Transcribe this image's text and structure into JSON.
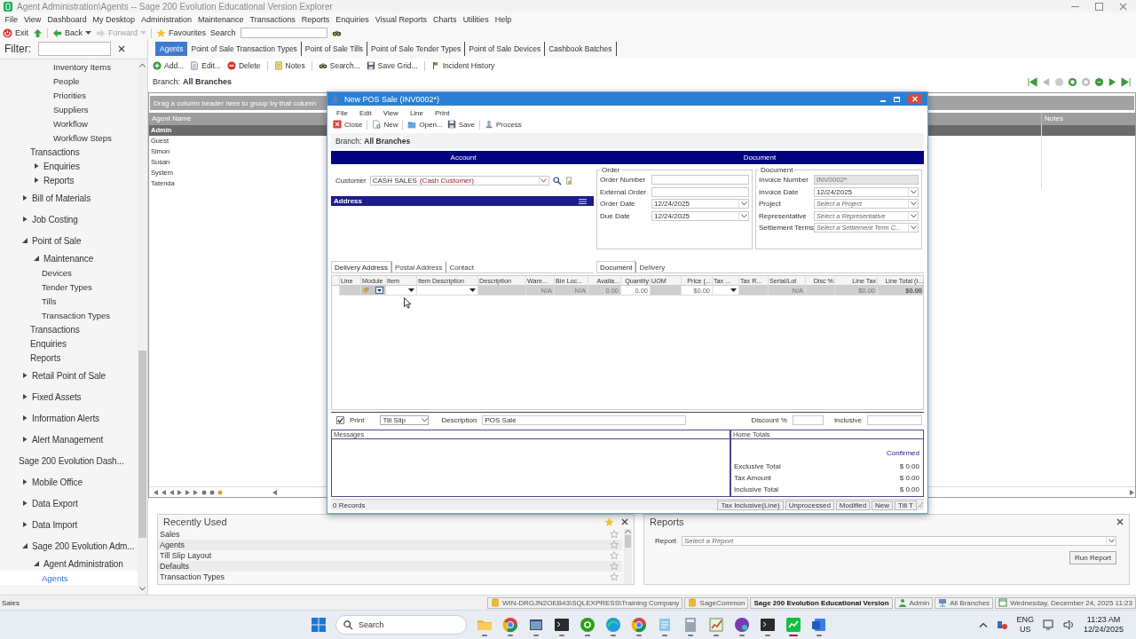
{
  "window": {
    "title": "Agent Administration\\Agents -- Sage 200 Evolution Educational Version Explorer"
  },
  "menu": [
    "File",
    "View",
    "Dashboard",
    "My Desktop",
    "Administration",
    "Maintenance",
    "Transactions",
    "Reports",
    "Enquiries",
    "Visual Reports",
    "Charts",
    "Utilities",
    "Help"
  ],
  "toolbar": [
    {
      "kind": "exit",
      "label": "Exit",
      "disabled": false
    },
    {
      "kind": "up",
      "disabled": false
    },
    {
      "kind": "back",
      "label": "Back",
      "disabled": false
    },
    {
      "kind": "forward",
      "label": "Forward",
      "disabled": true
    },
    {
      "kind": "favourites",
      "label": "Favourites",
      "disabled": false
    }
  ],
  "search": {
    "label": "Search"
  },
  "filter": {
    "label": "Filter:"
  },
  "sidebar": {
    "items": [
      {
        "children": [
          {
            "children": [
              {
                "children": [
                  {
                    "label": "Inventory Items",
                    "selected": false
                  },
                  {
                    "label": "People",
                    "selected": false
                  },
                  {
                    "label": "Priorities",
                    "selected": false
                  },
                  {
                    "label": "Suppliers",
                    "selected": false
                  },
                  {
                    "label": "Workflow",
                    "selected": false
                  },
                  {
                    "label": "Workflow Steps",
                    "selected": false
                  }
                ]
              }
            ]
          },
          {
            "label": "Transactions",
            "selected": false
          },
          {
            "label": "Enquiries",
            "expanded": false,
            "selected": false
          },
          {
            "label": "Reports",
            "expanded": false,
            "selected": false
          }
        ]
      },
      {
        "label": "Bill of Materials",
        "expanded": false,
        "selected": false
      },
      {
        "label": "Job Costing",
        "expanded": false,
        "selected": false
      },
      {
        "label": "Point of Sale",
        "expanded": true,
        "selected": false,
        "children": [
          {
            "label": "Maintenance",
            "expanded": true,
            "selected": false,
            "children": [
              {
                "label": "Devices",
                "selected": false
              },
              {
                "label": "Tender Types",
                "selected": false
              },
              {
                "label": "Tills",
                "selected": false
              },
              {
                "label": "Transaction Types",
                "selected": false
              }
            ]
          },
          {
            "label": "Transactions",
            "selected": false
          },
          {
            "label": "Enquiries",
            "selected": false
          },
          {
            "label": "Reports",
            "selected": false
          }
        ]
      },
      {
        "label": "Retail Point of Sale",
        "expanded": false,
        "selected": false
      },
      {
        "label": "Fixed Assets",
        "expanded": false,
        "selected": false
      },
      {
        "label": "Information Alerts",
        "expanded": false,
        "selected": false
      },
      {
        "label": "Alert Management",
        "expanded": false,
        "selected": false
      },
      {
        "label": "Sage 200 Evolution Dash...",
        "selected": false
      },
      {
        "label": "Mobile Office",
        "expanded": false,
        "selected": false
      },
      {
        "label": "Data Export",
        "expanded": false,
        "selected": false
      },
      {
        "label": "Data Import",
        "expanded": false,
        "selected": false
      },
      {
        "label": "Sage 200 Evolution Adm...",
        "expanded": true,
        "selected": false,
        "children": [
          {
            "label": "Agent Administration",
            "expanded": true,
            "selected": false,
            "children": [
              {
                "label": "Agents",
                "selected": true
              }
            ]
          }
        ]
      }
    ]
  },
  "tabs": [
    {
      "label": "Agents",
      "selected": true
    },
    {
      "label": "Point of Sale Transaction Types",
      "selected": false
    },
    {
      "label": "Point of Sale Tills",
      "selected": false
    },
    {
      "label": "Point of Sale Tender Types",
      "selected": false
    },
    {
      "label": "Point of Sale Devices",
      "selected": false
    },
    {
      "label": "Cashbook Batches",
      "selected": false
    }
  ],
  "actions": [
    {
      "kind": "add",
      "label": "Add..."
    },
    {
      "kind": "edit",
      "label": "Edit..."
    },
    {
      "kind": "delete",
      "label": "Delete"
    },
    {
      "kind": "notes",
      "label": "Notes"
    },
    {
      "kind": "search",
      "label": "Search..."
    },
    {
      "kind": "save",
      "label": "Save Grid..."
    },
    {
      "kind": "incident",
      "label": "Incident History"
    }
  ],
  "branch": {
    "label": "Branch:",
    "value": "All Branches"
  },
  "agents_grid": {
    "group_hint": "Drag a column header here to group by that column",
    "columns": [
      "Agent Name",
      "Notes"
    ],
    "rows": [
      {
        "name": "Admin",
        "selected": true
      },
      {
        "name": "Guest",
        "selected": false
      },
      {
        "name": "Simon",
        "selected": false
      },
      {
        "name": "Susan",
        "selected": false
      },
      {
        "name": "System",
        "selected": false
      },
      {
        "name": "Tatenda",
        "selected": false
      }
    ]
  },
  "dialog": {
    "title": "New POS Sale (INV0002*)",
    "menu": [
      "File",
      "Edit",
      "View",
      "Line",
      "Print"
    ],
    "toolbar": [
      {
        "kind": "close",
        "label": "Close"
      },
      {
        "kind": "new",
        "label": "New"
      },
      {
        "kind": "open",
        "label": "Open..."
      },
      {
        "kind": "save",
        "label": "Save"
      },
      {
        "kind": "process",
        "label": "Process"
      }
    ],
    "branch": {
      "label": "Branch:",
      "value": "All Branches"
    },
    "sections": [
      "Account",
      "Document"
    ],
    "customer": {
      "label": "Customer",
      "value": "CASH SALES",
      "note": "(Cash Customer)"
    },
    "address": {
      "title": "Address"
    },
    "order": {
      "title": "Order",
      "fields": [
        {
          "label": "Order Number",
          "kind": "text",
          "disabled": false
        },
        {
          "label": "External Order",
          "kind": "text",
          "disabled": false
        },
        {
          "label": "Order Date",
          "kind": "date",
          "value": "12/24/2025",
          "disabled": false
        },
        {
          "label": "Due Date",
          "kind": "date",
          "value": "12/24/2025",
          "disabled": false
        }
      ]
    },
    "document": {
      "title": "Document",
      "fields": [
        {
          "label": "Invoice Number",
          "kind": "text",
          "value": "INV0002*",
          "disabled": true
        },
        {
          "label": "Invoice Date",
          "kind": "date",
          "value": "12/24/2025",
          "disabled": false
        },
        {
          "label": "Project",
          "kind": "lookup",
          "placeholder": "Select a Project",
          "disabled": false
        },
        {
          "label": "Representative",
          "kind": "lookup",
          "placeholder": "Select a Representative",
          "disabled": false
        },
        {
          "label": "Settlement Terms",
          "kind": "lookup",
          "placeholder": "Select a Settlement Term C...",
          "disabled": false
        }
      ]
    },
    "address_tabs": [
      {
        "label": "Delivery Address",
        "selected": true
      },
      {
        "label": "Postal Address",
        "selected": false
      },
      {
        "label": "Contact",
        "selected": false
      }
    ],
    "document_tabs": [
      {
        "label": "Document",
        "selected": true
      },
      {
        "label": "Delivery",
        "selected": false
      }
    ],
    "lines": {
      "columns": [
        "Line",
        "Module",
        "Item",
        "Item Description",
        "Description",
        "Ware...",
        "Bin Loc...",
        "Availa...",
        "Quantity",
        "UOM",
        "Price (...",
        "Tax ...",
        "Tax R...",
        "Serial/Lot",
        "Disc %",
        "Line Tax",
        "Line Total (i..."
      ],
      "rows": [
        {
          "cells": [
            {
              "kind": "blank",
              "readonly": true
            },
            {
              "kind": "module",
              "readonly": false
            },
            {
              "kind": "dropdown",
              "readonly": false
            },
            {
              "kind": "dropdown",
              "readonly": false
            },
            {
              "kind": "blank",
              "readonly": true
            },
            {
              "kind": "text",
              "text": "N/A",
              "readonly": true
            },
            {
              "kind": "text",
              "text": "N/A",
              "readonly": true
            },
            {
              "kind": "text",
              "text": "0.00",
              "readonly": true
            },
            {
              "kind": "text",
              "text": "0.00",
              "readonly": false
            },
            {
              "kind": "blank",
              "readonly": true
            },
            {
              "kind": "text",
              "text": "$0.00",
              "readonly": false
            },
            {
              "kind": "dropdown",
              "readonly": false
            },
            {
              "kind": "blank",
              "readonly": true
            },
            {
              "kind": "text",
              "text": "N/A",
              "readonly": true
            },
            {
              "kind": "blank",
              "readonly": true
            },
            {
              "kind": "text",
              "text": "$0.00",
              "readonly": true
            },
            {
              "kind": "total",
              "text": "$0.00",
              "readonly": true
            }
          ]
        }
      ]
    },
    "footer": {
      "print": {
        "label": "Print",
        "checked": true
      },
      "slip": {
        "value": "Till Slip"
      },
      "description": {
        "label": "Description",
        "value": "POS Sale"
      },
      "discount": {
        "label": "Discount %"
      },
      "inclusive": {
        "label": "Inclusive"
      }
    },
    "messages": {
      "title": "Messages"
    },
    "totals": {
      "title": "Home Totals",
      "status": "Confirmed",
      "rows": [
        {
          "label": "Exclusive Total",
          "value": "$ 0.00"
        },
        {
          "label": "Tax Amount",
          "value": "$ 0.00"
        },
        {
          "label": "Inclusive Total",
          "value": "$ 0.00"
        }
      ]
    },
    "status": {
      "records": "0 Records",
      "cells": [
        "Tax Inclusive(Line)",
        "Unprocessed",
        "Modified",
        "New",
        "Till T"
      ]
    }
  },
  "recently_used": {
    "title": "Recently Used",
    "items": [
      "Sales",
      "Agents",
      "Till Slip Layout",
      "Defaults",
      "Transaction Types"
    ]
  },
  "reports": {
    "title": "Reports",
    "label": "Report",
    "placeholder": "Select a Report",
    "button": "Run Report"
  },
  "status_bar": {
    "left": "Sales",
    "cells": [
      {
        "kind": "database",
        "text": "WIN-DRGJN2OEB43\\SQLEXPRESS\\Training Company"
      },
      {
        "kind": "database",
        "text": "SageCommon"
      },
      {
        "kind": "plain",
        "text": "Sage 200 Evolution Educational Version"
      },
      {
        "kind": "user",
        "text": "Admin"
      },
      {
        "kind": "branch",
        "text": "All Branches"
      },
      {
        "kind": "calendar",
        "text": "Wednesday, December 24, 2025  11:23"
      }
    ]
  },
  "taskbar": {
    "search": "Search",
    "apps": [
      {
        "kind": "folder",
        "active": false
      },
      {
        "kind": "browser",
        "active": false
      },
      {
        "kind": "window",
        "active": false
      },
      {
        "kind": "terminal",
        "active": false
      },
      {
        "kind": "green",
        "active": false
      },
      {
        "kind": "edge",
        "active": false
      },
      {
        "kind": "browser",
        "active": false
      },
      {
        "kind": "notepad",
        "active": false
      },
      {
        "kind": "calculator",
        "active": false
      },
      {
        "kind": "chart",
        "active": false
      },
      {
        "kind": "purple",
        "active": false
      },
      {
        "kind": "terminal",
        "active": false
      },
      {
        "kind": "chart-green",
        "active": true
      },
      {
        "kind": "word",
        "active": false
      }
    ],
    "language": [
      "ENG",
      "US"
    ],
    "time": "11:23 AM",
    "date": "12/24/2025"
  }
}
